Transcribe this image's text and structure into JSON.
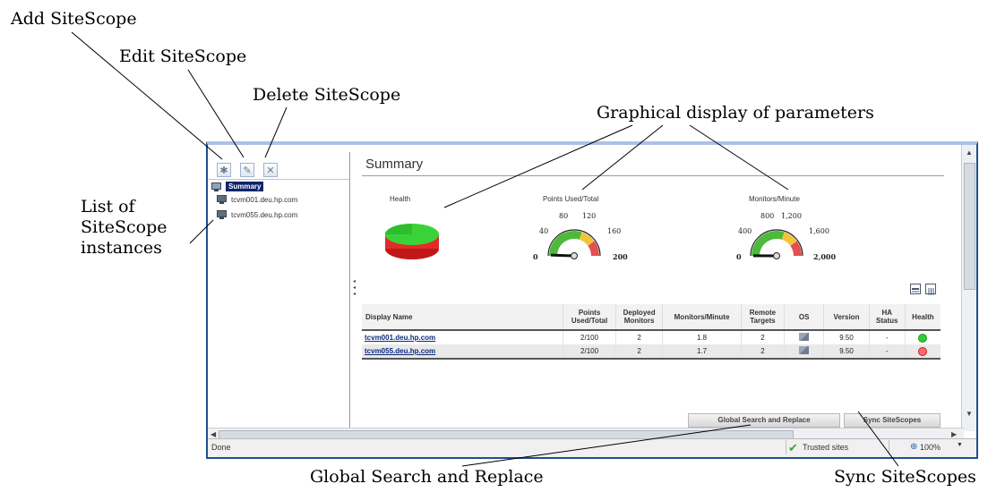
{
  "callouts": {
    "add": "Add SiteScope",
    "edit": "Edit SiteScope",
    "delete": "Delete SiteScope",
    "graphical": "Graphical display of parameters",
    "list_line1": "List of",
    "list_line2": "SiteScope",
    "list_line3": "instances",
    "global": "Global Search and Replace",
    "sync": "Sync SiteScopes"
  },
  "toolbar": {
    "add_icon": "✱",
    "edit_icon": "✎",
    "delete_icon": "✕"
  },
  "tree": {
    "root": "Summary",
    "items": [
      "tcvm001.deu.hp.com",
      "tcvm055.deu.hp.com"
    ]
  },
  "main": {
    "title": "Summary",
    "health_label": "Health",
    "points_label": "Points Used/Total",
    "monitors_label": "Monitors/Minute",
    "points_ticks": {
      "t0": "0",
      "t40": "40",
      "t80": "80",
      "t120": "120",
      "t160": "160",
      "t200": "200"
    },
    "monitors_ticks": {
      "t0": "0",
      "t400": "400",
      "t800": "800",
      "t1200": "1,200",
      "t1600": "1,600",
      "t2000": "2,000"
    },
    "gauges": {
      "points_value": 2,
      "points_max": 200,
      "monitors_value": 3.5,
      "monitors_max": 2000
    },
    "health_colors": {
      "ok": "#33cc33",
      "error": "#e02020"
    }
  },
  "table": {
    "headers": {
      "display_name": "Display Name",
      "points1": "Points",
      "points2": "Used/Total",
      "deployed1": "Deployed",
      "deployed2": "Monitors",
      "mpm": "Monitors/Minute",
      "remote1": "Remote",
      "remote2": "Targets",
      "os": "OS",
      "version": "Version",
      "ha1": "HA",
      "ha2": "Status",
      "health": "Health"
    },
    "rows": [
      {
        "name": "tcvm001.deu.hp.com",
        "points": "2/100",
        "deployed": "2",
        "mpm": "1.8",
        "remote": "2",
        "version": "9.50",
        "ha": "-",
        "health": "ok"
      },
      {
        "name": "tcvm055.deu.hp.com",
        "points": "2/100",
        "deployed": "2",
        "mpm": "1.7",
        "remote": "2",
        "version": "9.50",
        "ha": "-",
        "health": "error"
      }
    ]
  },
  "buttons": {
    "global": "Global Search and Replace",
    "sync": "Sync SiteScopes"
  },
  "status": {
    "left": "Done",
    "zone": "Trusted sites",
    "zoom": "100%"
  }
}
